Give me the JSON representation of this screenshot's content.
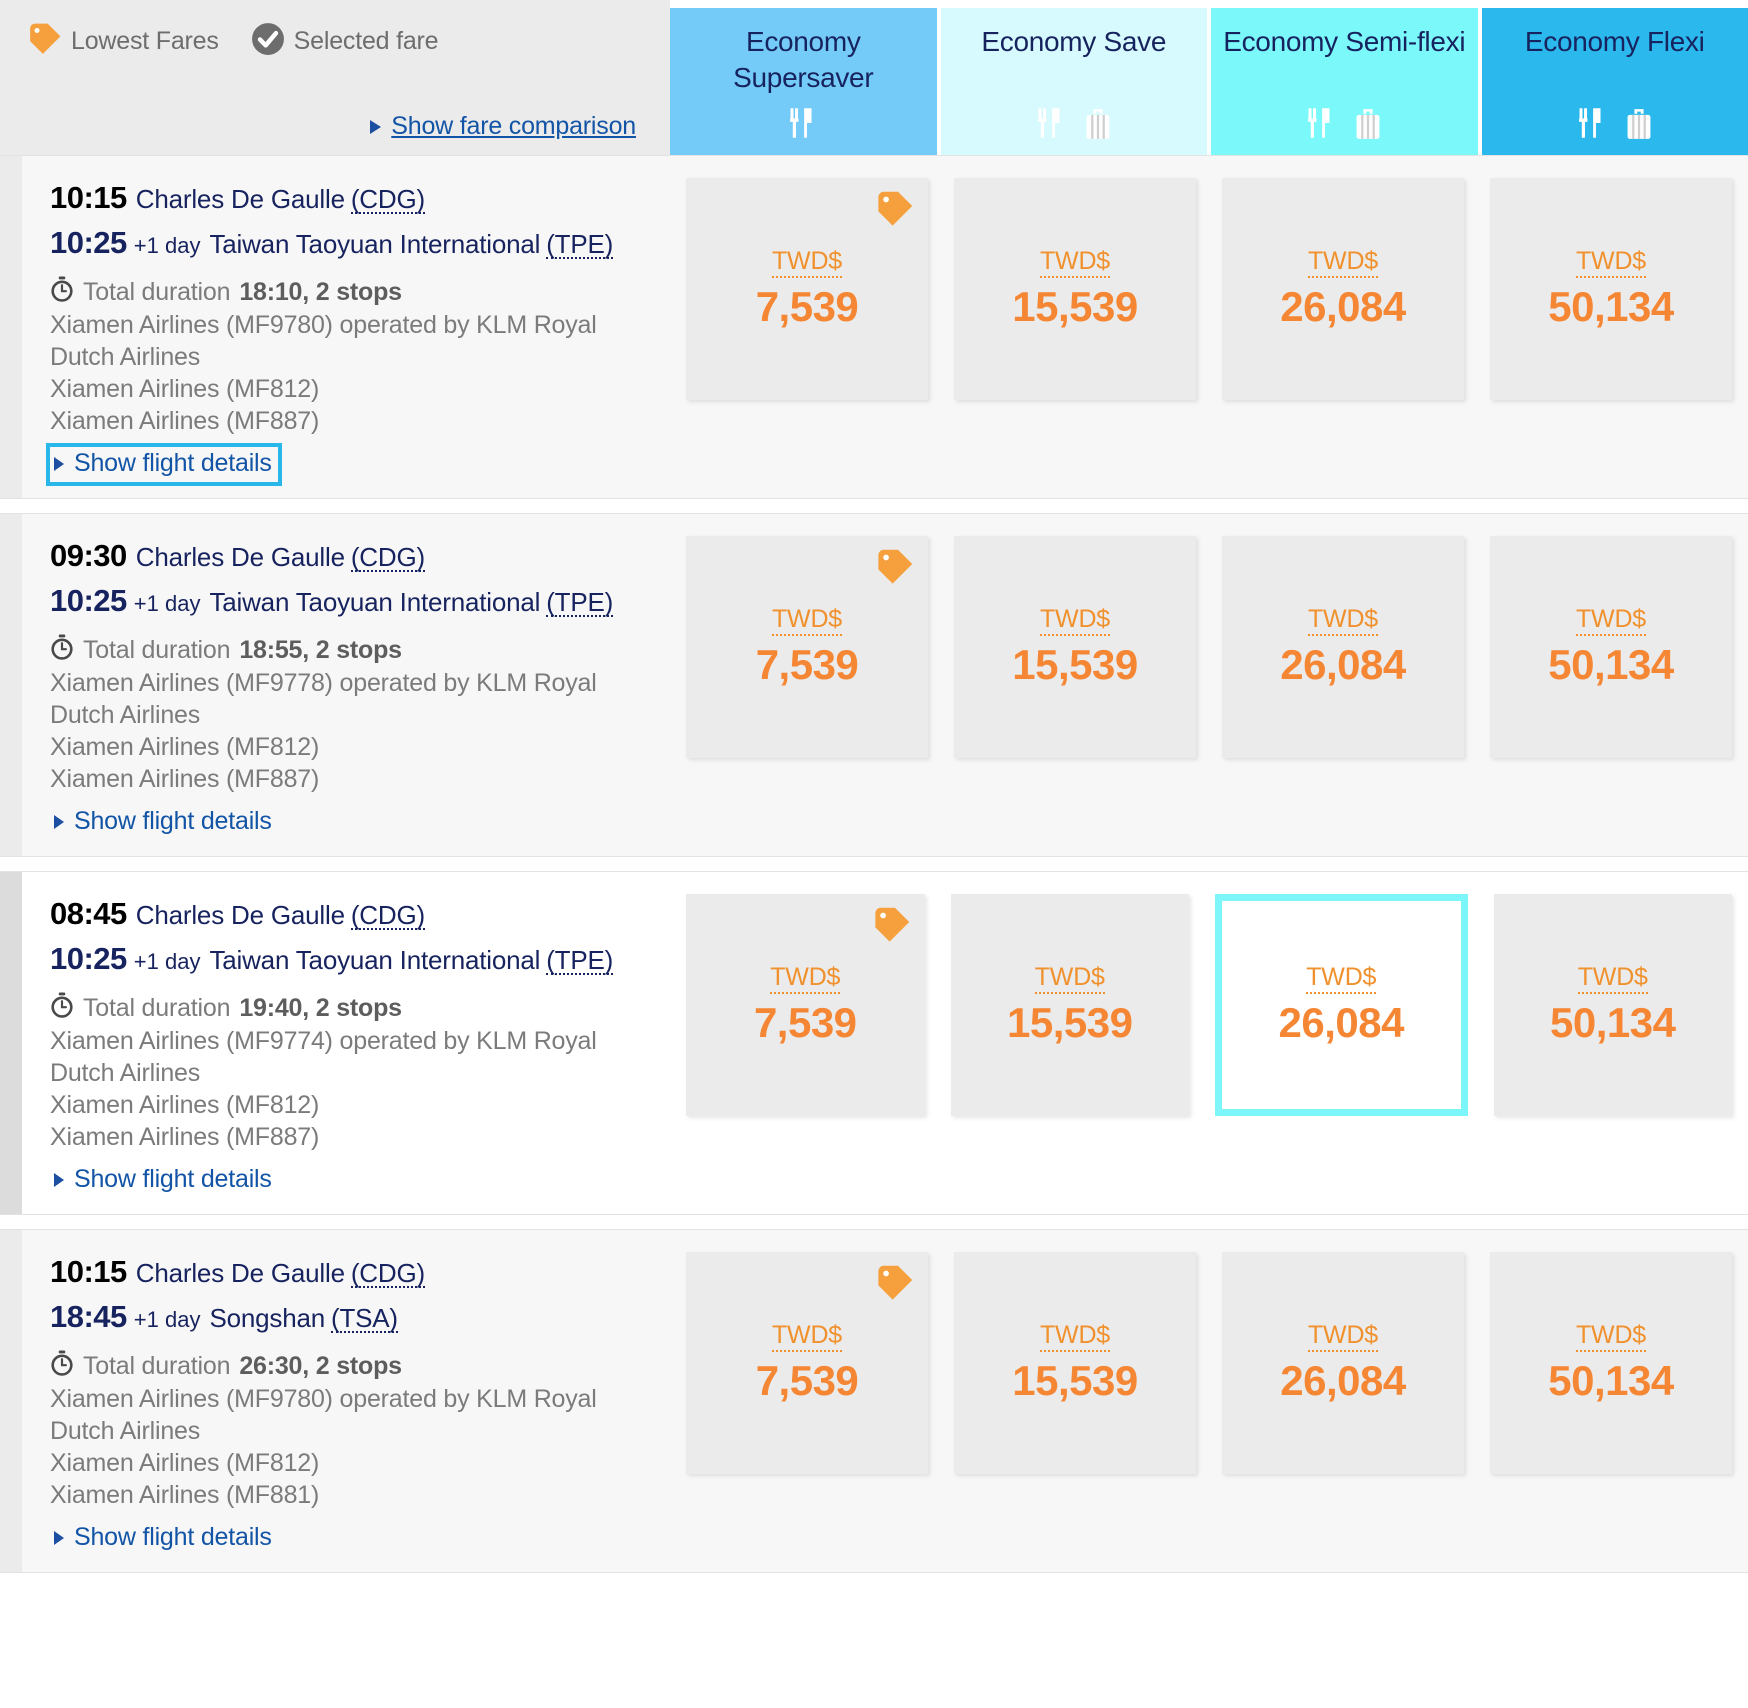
{
  "legend": {
    "lowest_fares_label": "Lowest Fares",
    "lowest_fares_icon": "price-tag-icon",
    "selected_fare_label": "Selected fare",
    "selected_fare_icon": "check-circle-icon",
    "show_fare_comparison_label": "Show fare comparison",
    "expand_icon": "triangle-right-icon"
  },
  "fare_columns": [
    {
      "title": "Economy Supersaver",
      "bg": "#74cbf7",
      "icons": [
        "meal-icon"
      ]
    },
    {
      "title": "Economy Save",
      "bg": "#d6fafd",
      "icons": [
        "meal-icon",
        "baggage-icon"
      ]
    },
    {
      "title": "Economy Semi-flexi",
      "bg": "#7bf9fa",
      "icons": [
        "meal-icon",
        "baggage-icon"
      ]
    },
    {
      "title": "Economy Flexi",
      "bg": "#2bb8ed",
      "icons": [
        "meal-icon",
        "baggage-icon"
      ]
    }
  ],
  "currency_label": "TWD$",
  "details_link_label": "Show flight details",
  "duration_prefix": "Total duration",
  "clock_icon": "stopwatch-icon",
  "colors": {
    "price_orange": "#f58634",
    "tag_orange": "#f5a03c",
    "link_blue": "#1254a6",
    "navy": "#17235e",
    "focus_cyan": "#29b6e8",
    "selected_cyan": "#7df6fa"
  },
  "flights": [
    {
      "depart_time": "10:15",
      "depart_airport": "Charles De Gaulle",
      "depart_code": "(CDG)",
      "arrive_time": "10:25",
      "arrive_day_offset": "+1 day",
      "arrive_airport": "Taiwan Taoyuan International",
      "arrive_code": "(TPE)",
      "duration": "18:10, 2 stops",
      "airlines": [
        "Xiamen Airlines (MF9780) operated by KLM Royal Dutch Airlines",
        "Xiamen Airlines (MF812)",
        "Xiamen Airlines (MF887)"
      ],
      "details_focused": true,
      "row_highlight": false,
      "prices": [
        {
          "amount": "7,539",
          "lowest": true,
          "selected": false
        },
        {
          "amount": "15,539",
          "lowest": false,
          "selected": false
        },
        {
          "amount": "26,084",
          "lowest": false,
          "selected": false
        },
        {
          "amount": "50,134",
          "lowest": false,
          "selected": false
        }
      ]
    },
    {
      "depart_time": "09:30",
      "depart_airport": "Charles De Gaulle",
      "depart_code": "(CDG)",
      "arrive_time": "10:25",
      "arrive_day_offset": "+1 day",
      "arrive_airport": "Taiwan Taoyuan International",
      "arrive_code": "(TPE)",
      "duration": "18:55, 2 stops",
      "airlines": [
        "Xiamen Airlines (MF9778) operated by KLM Royal Dutch Airlines",
        "Xiamen Airlines (MF812)",
        "Xiamen Airlines (MF887)"
      ],
      "details_focused": false,
      "row_highlight": false,
      "prices": [
        {
          "amount": "7,539",
          "lowest": true,
          "selected": false
        },
        {
          "amount": "15,539",
          "lowest": false,
          "selected": false
        },
        {
          "amount": "26,084",
          "lowest": false,
          "selected": false
        },
        {
          "amount": "50,134",
          "lowest": false,
          "selected": false
        }
      ]
    },
    {
      "depart_time": "08:45",
      "depart_airport": "Charles De Gaulle",
      "depart_code": "(CDG)",
      "arrive_time": "10:25",
      "arrive_day_offset": "+1 day",
      "arrive_airport": "Taiwan Taoyuan International",
      "arrive_code": "(TPE)",
      "duration": "19:40, 2 stops",
      "airlines": [
        "Xiamen Airlines (MF9774) operated by KLM Royal Dutch Airlines",
        "Xiamen Airlines (MF812)",
        "Xiamen Airlines (MF887)"
      ],
      "details_focused": false,
      "row_highlight": true,
      "prices": [
        {
          "amount": "7,539",
          "lowest": true,
          "selected": false
        },
        {
          "amount": "15,539",
          "lowest": false,
          "selected": false
        },
        {
          "amount": "26,084",
          "lowest": false,
          "selected": true
        },
        {
          "amount": "50,134",
          "lowest": false,
          "selected": false
        }
      ]
    },
    {
      "depart_time": "10:15",
      "depart_airport": "Charles De Gaulle",
      "depart_code": "(CDG)",
      "arrive_time": "18:45",
      "arrive_day_offset": "+1 day",
      "arrive_airport": "Songshan",
      "arrive_code": "(TSA)",
      "duration": "26:30, 2 stops",
      "airlines": [
        "Xiamen Airlines (MF9780) operated by KLM Royal Dutch Airlines",
        "Xiamen Airlines (MF812)",
        "Xiamen Airlines (MF881)"
      ],
      "details_focused": false,
      "row_highlight": false,
      "prices": [
        {
          "amount": "7,539",
          "lowest": true,
          "selected": false
        },
        {
          "amount": "15,539",
          "lowest": false,
          "selected": false
        },
        {
          "amount": "26,084",
          "lowest": false,
          "selected": false
        },
        {
          "amount": "50,134",
          "lowest": false,
          "selected": false
        }
      ]
    }
  ]
}
